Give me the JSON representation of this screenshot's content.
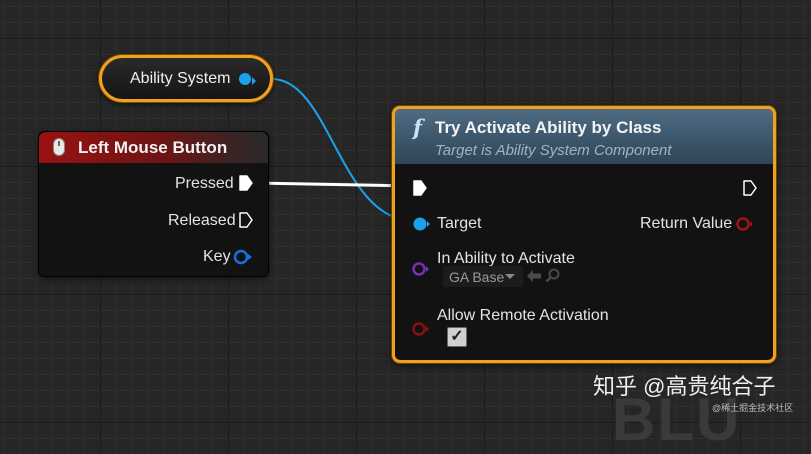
{
  "variable_node": {
    "label": "Ability System"
  },
  "event_node": {
    "title": "Left Mouse Button",
    "pins": {
      "pressed": "Pressed",
      "released": "Released",
      "key": "Key"
    }
  },
  "function_node": {
    "icon": "f",
    "title": "Try Activate Ability by Class",
    "subtitle": "Target is Ability System Component",
    "pins": {
      "target": "Target",
      "return_value": "Return Value",
      "in_ability": "In Ability to Activate",
      "allow_remote": "Allow Remote Activation"
    },
    "ability_dropdown": {
      "selected": "GA Base"
    },
    "allow_remote_checked": true
  },
  "watermark": {
    "main": "知乎 @高贵纯合子",
    "corner": "@稀土掘金技术社区"
  },
  "colors": {
    "selection_border": "#f0a21e",
    "object_pin": "#1aa3ea",
    "class_pin": "#7b2fb5",
    "bool_pin": "#8a1111",
    "exec_wire": "#ffffff"
  }
}
